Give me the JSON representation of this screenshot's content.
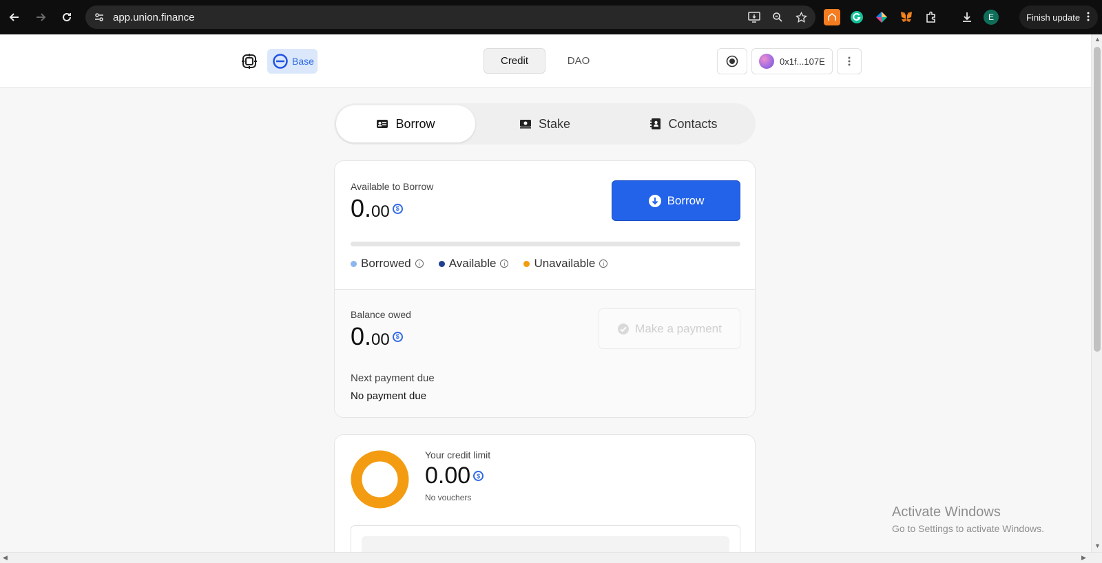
{
  "browser": {
    "url": "app.union.finance",
    "profile_initial": "E",
    "finish_update_label": "Finish update"
  },
  "header": {
    "network_label": "Base",
    "tabs": [
      {
        "label": "Credit"
      },
      {
        "label": "DAO"
      }
    ],
    "wallet_address": "0x1f...107E"
  },
  "section_tabs": [
    {
      "label": "Borrow"
    },
    {
      "label": "Stake"
    },
    {
      "label": "Contacts"
    }
  ],
  "borrow_card": {
    "available_label": "Available to Borrow",
    "available_int": "0.",
    "available_dec": "00",
    "borrow_button": "Borrow",
    "borrowed_fraction": 0.0,
    "legend": [
      {
        "label": "Borrowed",
        "color": "#8bb7ee"
      },
      {
        "label": "Available",
        "color": "#1f3f8f"
      },
      {
        "label": "Unavailable",
        "color": "#f39c12"
      }
    ],
    "balance_label": "Balance owed",
    "balance_int": "0.",
    "balance_dec": "00",
    "make_payment_button": "Make a payment",
    "next_payment_label": "Next payment due",
    "next_payment_value": "No payment due"
  },
  "credit_card": {
    "limit_label": "Your credit limit",
    "limit_value": "0.00",
    "vouchers_text": "No vouchers",
    "ring_color": "#f39c12"
  },
  "watermark": {
    "line1": "Activate Windows",
    "line2": "Go to Settings to activate Windows."
  },
  "colors": {
    "accent": "#2363ea",
    "usdc": "#2e6ae6"
  }
}
